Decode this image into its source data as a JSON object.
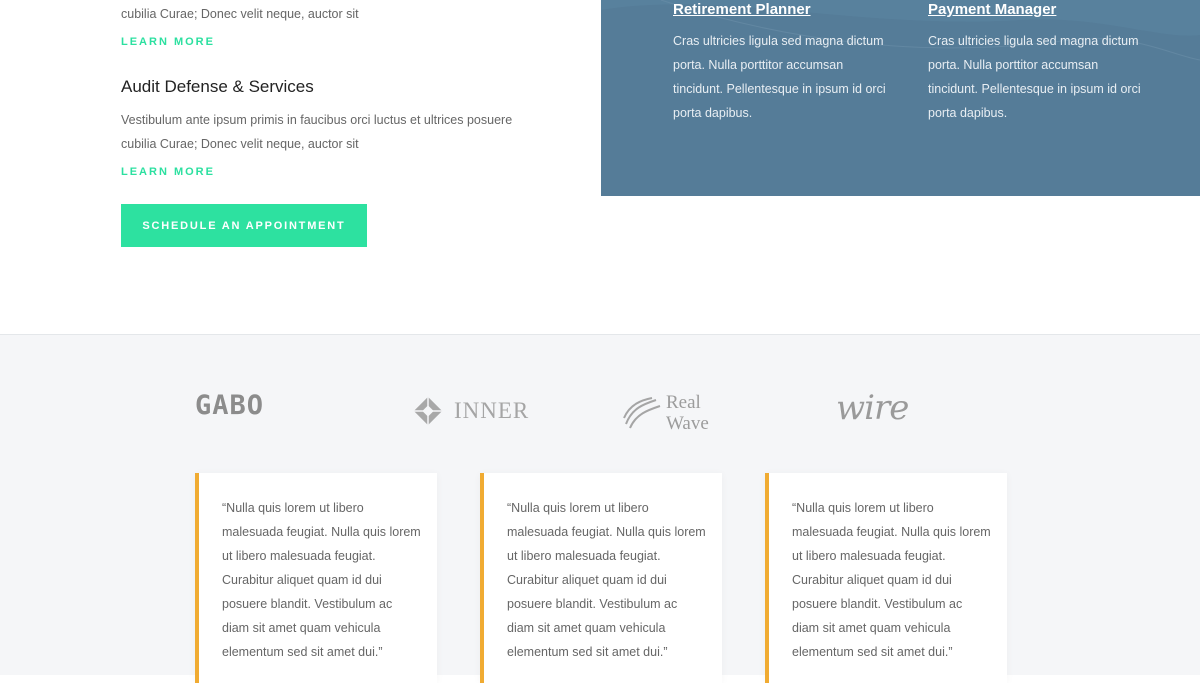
{
  "services": {
    "first": {
      "text_tail": "cubilia Curae; Donec velit neque, auctor sit",
      "link": "LEARN MORE"
    },
    "second": {
      "title": "Audit Defense & Services",
      "text": "Vestibulum ante ipsum primis in faucibus orci luctus et ultrices posuere cubilia Curae; Donec velit neque, auctor sit",
      "link": "LEARN MORE"
    },
    "cta_label": "SCHEDULE AN APPOINTMENT"
  },
  "panel": {
    "columns": [
      {
        "title": "Retirement Planner",
        "text": "Cras ultricies ligula sed magna dictum porta. Nulla porttitor accumsan tincidunt. Pellentesque in ipsum id orci porta dapibus."
      },
      {
        "title": "Payment Manager",
        "text": "Cras ultricies ligula sed magna dictum porta. Nulla porttitor accumsan tincidunt. Pellentesque in ipsum id orci porta dapibus."
      }
    ]
  },
  "logos": {
    "gabo": "GABO",
    "inner": "INNER",
    "realwave_line1": "Real",
    "realwave_line2": "Wave",
    "wire": "wire"
  },
  "testimonials": [
    {
      "quote": "“Nulla quis lorem ut libero malesuada feugiat. Nulla quis lorem ut libero malesuada feugiat. Curabitur aliquet quam id dui posuere blandit. Vestibulum ac diam sit amet quam vehicula elementum sed sit amet dui.”"
    },
    {
      "quote": "“Nulla quis lorem ut libero malesuada feugiat. Nulla quis lorem ut libero malesuada feugiat. Curabitur aliquet quam id dui posuere blandit. Vestibulum ac diam sit amet quam vehicula elementum sed sit amet dui.”"
    },
    {
      "quote": "“Nulla quis lorem ut libero malesuada feugiat. Nulla quis lorem ut libero malesuada feugiat. Curabitur aliquet quam id dui posuere blandit. Vestibulum ac diam sit amet quam vehicula elementum sed sit amet dui.”"
    }
  ],
  "colors": {
    "accent_green": "#2de1a0",
    "panel_blue": "#557c98",
    "quote_border": "#f0ab32"
  }
}
